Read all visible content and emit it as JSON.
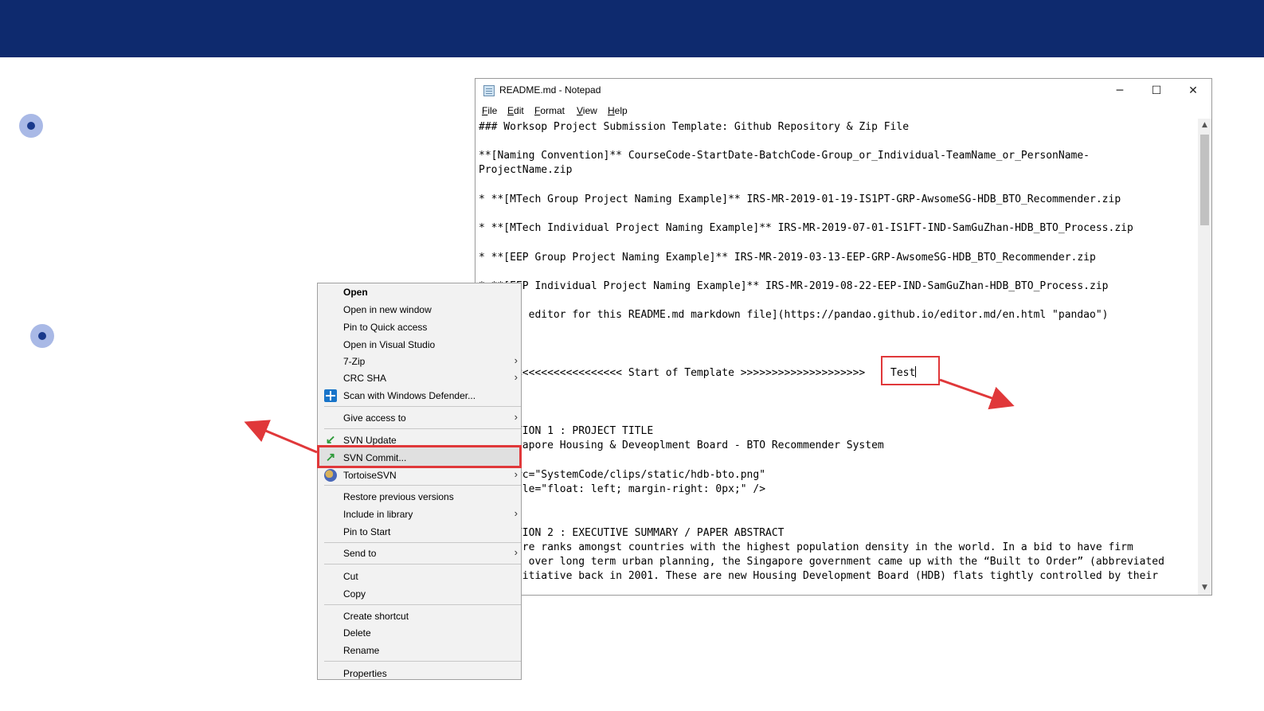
{
  "notepad": {
    "title": "README.md - Notepad",
    "controls": {
      "minimize": "─",
      "maximize": "☐",
      "close": "✕"
    },
    "menu": [
      "File",
      "Edit",
      "Format",
      "View",
      "Help"
    ],
    "lines": [
      "### Worksop Project Submission Template: Github Repository & Zip File",
      "**[Naming Convention]** CourseCode-StartDate-BatchCode-Group_or_Individual-TeamName_or_PersonName-",
      "ProjectName.zip",
      "* **[MTech Group Project Naming Example]** IRS-MR-2019-01-19-IS1PT-GRP-AwsomeSG-HDB_BTO_Recommender.zip",
      "* **[MTech Individual Project Naming Example]** IRS-MR-2019-07-01-IS1FT-IND-SamGuZhan-HDB_BTO_Process.zip",
      "* **[EEP Group Project Naming Example]** IRS-MR-2019-03-13-EEP-GRP-AwsomeSG-HDB_BTO_Recommender.zip",
      "* **[EEP Individual Project Naming Example]** IRS-MR-2019-08-22-EEP-IND-SamGuZhan-HDB_BTO_Process.zip",
      "[Online editor for this README.md markdown file](https://pandao.github.io/editor.md/en.html \"pandao\")",
      "## <<<<<<<<<<<<<<<<<<<< Start of Template >>>>>>>>>>>>>>>>>>>>",
      "## SECTION 1 : PROJECT TITLE",
      "## Singapore Housing & Deveoplment Board - BTO Recommender System",
      "<img src=\"SystemCode/clips/static/hdb-bto.png\"",
      "    style=\"float: left; margin-right: 0px;\" />",
      "## SECTION 2 : EXECUTIVE SUMMARY / PAPER ABSTRACT",
      "Singapore ranks amongst countries with the highest population density in the world. In a bid to have firm",
      "control over long term urban planning, the Singapore government came up with the “Built to Order” (abbreviated",
      "BTO) initiative back in 2001. These are new Housing Development Board (HDB) flats tightly controlled by their"
    ],
    "typed_text": "Test"
  },
  "context_menu": {
    "items": [
      {
        "label": "Open",
        "bold": true
      },
      {
        "label": "Open in new window"
      },
      {
        "label": "Pin to Quick access"
      },
      {
        "label": "Open in Visual Studio"
      },
      {
        "label": "7-Zip",
        "submenu": true
      },
      {
        "label": "CRC SHA",
        "submenu": true
      },
      {
        "label": "Scan with Windows Defender...",
        "icon": "windows-defender-icon"
      },
      {
        "label": "Give access to",
        "submenu": true
      },
      {
        "label": "SVN Update",
        "icon": "svn-update-icon"
      },
      {
        "label": "SVN Commit...",
        "icon": "svn-commit-icon",
        "highlighted": true
      },
      {
        "label": "TortoiseSVN",
        "icon": "tortoisesvn-icon",
        "submenu": true
      },
      {
        "label": "Restore previous versions"
      },
      {
        "label": "Include in library",
        "submenu": true
      },
      {
        "label": "Pin to Start"
      },
      {
        "label": "Send to",
        "submenu": true
      },
      {
        "label": "Cut"
      },
      {
        "label": "Copy"
      },
      {
        "label": "Create shortcut"
      },
      {
        "label": "Delete"
      },
      {
        "label": "Rename"
      },
      {
        "label": "Properties"
      }
    ],
    "submenu_glyph": "›"
  },
  "colors": {
    "banner": "#0e2a6e",
    "annotation_red": "#e0383a",
    "bullet_outer": "#a9b9e6",
    "bullet_inner": "#1a3a8c"
  }
}
